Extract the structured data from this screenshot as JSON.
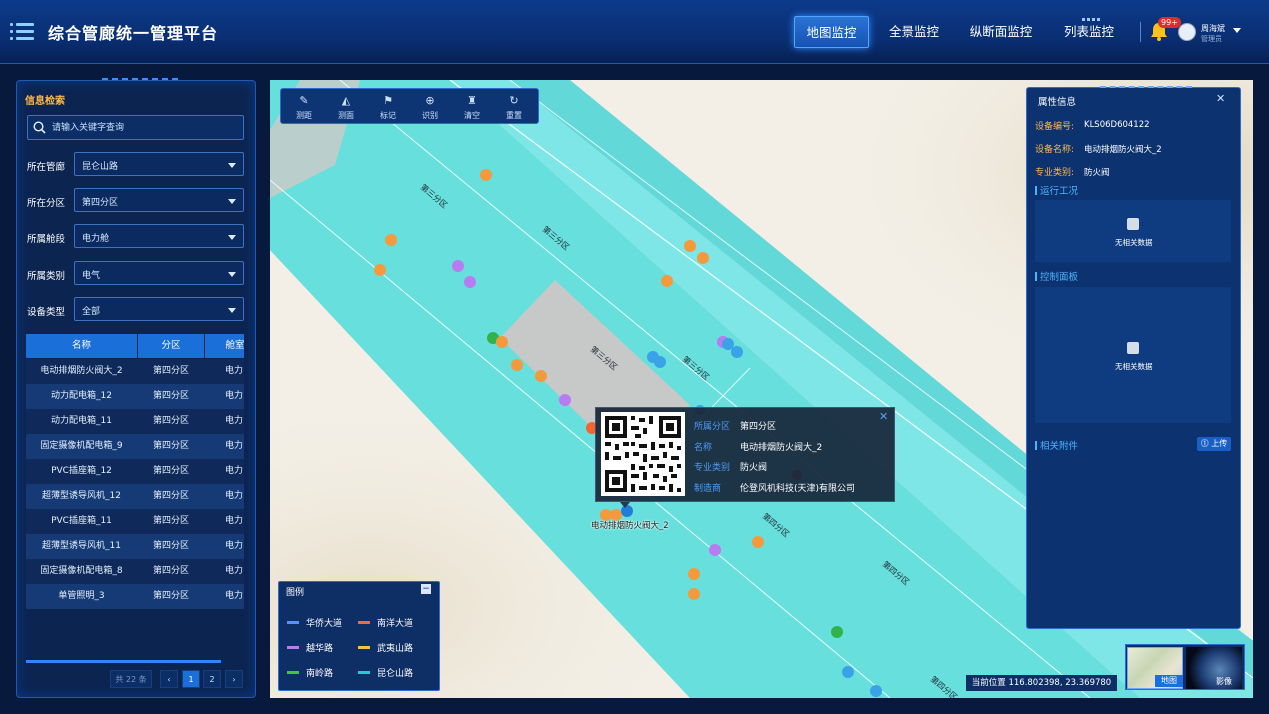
{
  "header": {
    "title": "综合管廊统一管理平台",
    "tabs": [
      "地图监控",
      "全景监控",
      "纵断面监控",
      "列表监控"
    ],
    "active_tab": "地图监控",
    "notification_badge": "99+",
    "user_name": "周海斌",
    "user_role": "管理员"
  },
  "search_panel": {
    "title": "信息检索",
    "search_placeholder": "请输入关键字查询",
    "filters": [
      {
        "label": "所在管廊",
        "value": "昆仑山路"
      },
      {
        "label": "所在分区",
        "value": "第四分区"
      },
      {
        "label": "所属舱段",
        "value": "电力舱"
      },
      {
        "label": "所属类别",
        "value": "电气"
      },
      {
        "label": "设备类型",
        "value": "全部"
      }
    ],
    "table": {
      "headers": [
        "名称",
        "分区",
        "舱室"
      ],
      "rows": [
        [
          "电动排烟防火阀大_2",
          "第四分区",
          "电力"
        ],
        [
          "动力配电箱_12",
          "第四分区",
          "电力"
        ],
        [
          "动力配电箱_11",
          "第四分区",
          "电力"
        ],
        [
          "固定摄像机配电箱_9",
          "第四分区",
          "电力"
        ],
        [
          "PVC插座箱_12",
          "第四分区",
          "电力"
        ],
        [
          "超薄型诱导风机_12",
          "第四分区",
          "电力"
        ],
        [
          "PVC插座箱_11",
          "第四分区",
          "电力"
        ],
        [
          "超薄型诱导风机_11",
          "第四分区",
          "电力"
        ],
        [
          "固定摄像机配电箱_8",
          "第四分区",
          "电力"
        ],
        [
          "单管照明_3",
          "第四分区",
          "电力"
        ]
      ]
    },
    "pagination": {
      "total": "共 22 条",
      "prev": "‹",
      "pages": [
        "1",
        "2"
      ],
      "next": "›"
    }
  },
  "map": {
    "toolbar": [
      "测距",
      "测面",
      "标记",
      "识别",
      "清空",
      "重置"
    ],
    "zone_labels": [
      "第三分区",
      "第三分区",
      "第三分区",
      "第三分区",
      "第四分区",
      "第四分区",
      "第四分区"
    ],
    "popup": {
      "fields": [
        {
          "label": "所属分区",
          "value": "第四分区"
        },
        {
          "label": "名称",
          "value": "电动排烟防火阀大_2"
        },
        {
          "label": "专业类别",
          "value": "防火阀"
        },
        {
          "label": "制造商",
          "value": "伦登风机科技(天津)有限公司"
        }
      ]
    },
    "marker_label": "电动排烟防火阀大_2",
    "legend": {
      "title": "图例",
      "items": [
        {
          "label": "华侨大道",
          "color": "#5b8ff9"
        },
        {
          "label": "南洋大道",
          "color": "#f26b3a"
        },
        {
          "label": "越华路",
          "color": "#b77cf2"
        },
        {
          "label": "武夷山路",
          "color": "#f7c22f"
        },
        {
          "label": "南岭路",
          "color": "#48c23a"
        },
        {
          "label": "昆仑山路",
          "color": "#27c8d8"
        }
      ]
    },
    "coordinates_text": "当前位置 116.802398, 23.369780",
    "basemap": {
      "map_label": "地图",
      "satellite_label": "影像"
    }
  },
  "properties_panel": {
    "title": "属性信息",
    "fields": [
      {
        "label": "设备编号:",
        "value": "KLS06D604122"
      },
      {
        "label": "设备名称:",
        "value": "电动排烟防火阀大_2"
      },
      {
        "label": "专业类别:",
        "value": "防火阀"
      }
    ],
    "sections": [
      "运行工况",
      "控制面板",
      "相关附件"
    ],
    "no_data": "无相关数据",
    "upload_label": "上传"
  }
}
